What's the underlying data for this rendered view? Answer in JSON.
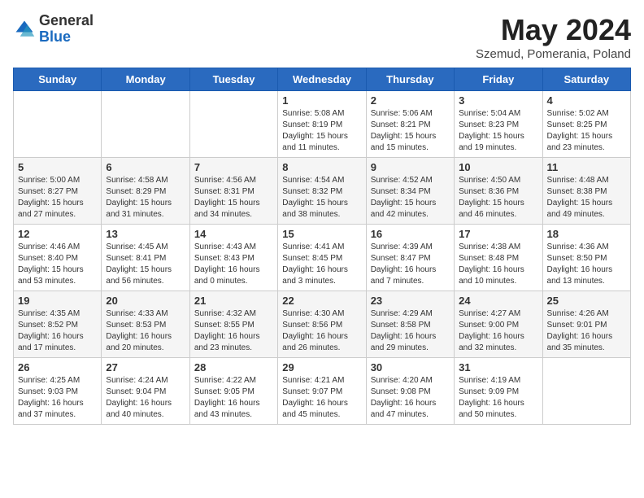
{
  "header": {
    "logo_general": "General",
    "logo_blue": "Blue",
    "month_title": "May 2024",
    "subtitle": "Szemud, Pomerania, Poland"
  },
  "days_of_week": [
    "Sunday",
    "Monday",
    "Tuesday",
    "Wednesday",
    "Thursday",
    "Friday",
    "Saturday"
  ],
  "weeks": [
    [
      {
        "day": "",
        "content": ""
      },
      {
        "day": "",
        "content": ""
      },
      {
        "day": "",
        "content": ""
      },
      {
        "day": "1",
        "content": "Sunrise: 5:08 AM\nSunset: 8:19 PM\nDaylight: 15 hours and 11 minutes."
      },
      {
        "day": "2",
        "content": "Sunrise: 5:06 AM\nSunset: 8:21 PM\nDaylight: 15 hours and 15 minutes."
      },
      {
        "day": "3",
        "content": "Sunrise: 5:04 AM\nSunset: 8:23 PM\nDaylight: 15 hours and 19 minutes."
      },
      {
        "day": "4",
        "content": "Sunrise: 5:02 AM\nSunset: 8:25 PM\nDaylight: 15 hours and 23 minutes."
      }
    ],
    [
      {
        "day": "5",
        "content": "Sunrise: 5:00 AM\nSunset: 8:27 PM\nDaylight: 15 hours and 27 minutes."
      },
      {
        "day": "6",
        "content": "Sunrise: 4:58 AM\nSunset: 8:29 PM\nDaylight: 15 hours and 31 minutes."
      },
      {
        "day": "7",
        "content": "Sunrise: 4:56 AM\nSunset: 8:31 PM\nDaylight: 15 hours and 34 minutes."
      },
      {
        "day": "8",
        "content": "Sunrise: 4:54 AM\nSunset: 8:32 PM\nDaylight: 15 hours and 38 minutes."
      },
      {
        "day": "9",
        "content": "Sunrise: 4:52 AM\nSunset: 8:34 PM\nDaylight: 15 hours and 42 minutes."
      },
      {
        "day": "10",
        "content": "Sunrise: 4:50 AM\nSunset: 8:36 PM\nDaylight: 15 hours and 46 minutes."
      },
      {
        "day": "11",
        "content": "Sunrise: 4:48 AM\nSunset: 8:38 PM\nDaylight: 15 hours and 49 minutes."
      }
    ],
    [
      {
        "day": "12",
        "content": "Sunrise: 4:46 AM\nSunset: 8:40 PM\nDaylight: 15 hours and 53 minutes."
      },
      {
        "day": "13",
        "content": "Sunrise: 4:45 AM\nSunset: 8:41 PM\nDaylight: 15 hours and 56 minutes."
      },
      {
        "day": "14",
        "content": "Sunrise: 4:43 AM\nSunset: 8:43 PM\nDaylight: 16 hours and 0 minutes."
      },
      {
        "day": "15",
        "content": "Sunrise: 4:41 AM\nSunset: 8:45 PM\nDaylight: 16 hours and 3 minutes."
      },
      {
        "day": "16",
        "content": "Sunrise: 4:39 AM\nSunset: 8:47 PM\nDaylight: 16 hours and 7 minutes."
      },
      {
        "day": "17",
        "content": "Sunrise: 4:38 AM\nSunset: 8:48 PM\nDaylight: 16 hours and 10 minutes."
      },
      {
        "day": "18",
        "content": "Sunrise: 4:36 AM\nSunset: 8:50 PM\nDaylight: 16 hours and 13 minutes."
      }
    ],
    [
      {
        "day": "19",
        "content": "Sunrise: 4:35 AM\nSunset: 8:52 PM\nDaylight: 16 hours and 17 minutes."
      },
      {
        "day": "20",
        "content": "Sunrise: 4:33 AM\nSunset: 8:53 PM\nDaylight: 16 hours and 20 minutes."
      },
      {
        "day": "21",
        "content": "Sunrise: 4:32 AM\nSunset: 8:55 PM\nDaylight: 16 hours and 23 minutes."
      },
      {
        "day": "22",
        "content": "Sunrise: 4:30 AM\nSunset: 8:56 PM\nDaylight: 16 hours and 26 minutes."
      },
      {
        "day": "23",
        "content": "Sunrise: 4:29 AM\nSunset: 8:58 PM\nDaylight: 16 hours and 29 minutes."
      },
      {
        "day": "24",
        "content": "Sunrise: 4:27 AM\nSunset: 9:00 PM\nDaylight: 16 hours and 32 minutes."
      },
      {
        "day": "25",
        "content": "Sunrise: 4:26 AM\nSunset: 9:01 PM\nDaylight: 16 hours and 35 minutes."
      }
    ],
    [
      {
        "day": "26",
        "content": "Sunrise: 4:25 AM\nSunset: 9:03 PM\nDaylight: 16 hours and 37 minutes."
      },
      {
        "day": "27",
        "content": "Sunrise: 4:24 AM\nSunset: 9:04 PM\nDaylight: 16 hours and 40 minutes."
      },
      {
        "day": "28",
        "content": "Sunrise: 4:22 AM\nSunset: 9:05 PM\nDaylight: 16 hours and 43 minutes."
      },
      {
        "day": "29",
        "content": "Sunrise: 4:21 AM\nSunset: 9:07 PM\nDaylight: 16 hours and 45 minutes."
      },
      {
        "day": "30",
        "content": "Sunrise: 4:20 AM\nSunset: 9:08 PM\nDaylight: 16 hours and 47 minutes."
      },
      {
        "day": "31",
        "content": "Sunrise: 4:19 AM\nSunset: 9:09 PM\nDaylight: 16 hours and 50 minutes."
      },
      {
        "day": "",
        "content": ""
      }
    ]
  ]
}
